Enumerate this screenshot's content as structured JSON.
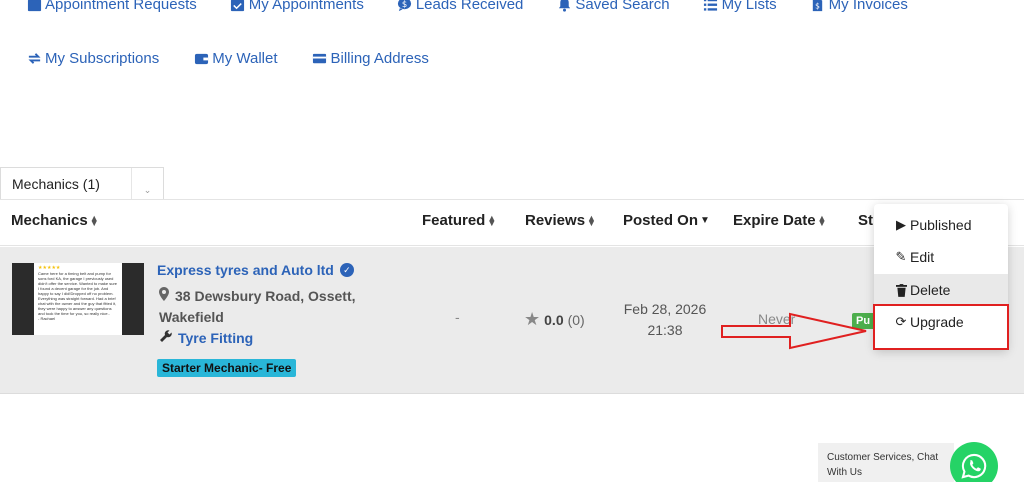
{
  "nav": {
    "row1": [
      {
        "label": "Appointment Requests",
        "icon": "calendar-icon"
      },
      {
        "label": "My Appointments",
        "icon": "calendar-check-icon"
      },
      {
        "label": "Leads Received",
        "icon": "dollar-bubble-icon"
      },
      {
        "label": "Saved Search",
        "icon": "bell-icon"
      },
      {
        "label": "My Lists",
        "icon": "list-icon"
      },
      {
        "label": "My Invoices",
        "icon": "invoice-icon"
      }
    ],
    "row2": [
      {
        "label": "My Subscriptions",
        "icon": "sync-icon"
      },
      {
        "label": "My Wallet",
        "icon": "wallet-icon"
      },
      {
        "label": "Billing Address",
        "icon": "card-icon"
      }
    ]
  },
  "tab": {
    "label": "Mechanics (1)",
    "caret": "⌄"
  },
  "table": {
    "headers": {
      "mechanics": "Mechanics",
      "featured": "Featured",
      "reviews": "Reviews",
      "posted_on": "Posted On",
      "expire_date": "Expire Date",
      "status": "St"
    },
    "row": {
      "thumbnail_text": "Came here for a timing belt and pump for sons ford KA, the garage I previously used didn't offer the service. Wanted to make sure I found a decent garage for the job. And happy to say I did!Dropped off no problem. Everything was straight forward. Had a brief chat with the owner and the guy that fitted it, they were happy to answer any questions and took the time for you, so really nice..",
      "thumbnail_author": "- Rachael",
      "thumbnail_stars": "★★★★★",
      "title": "Express tyres and Auto ltd",
      "verified_mark": "✓",
      "address": "38 Dewsbury Road, Ossett, Wakefield",
      "category": "Tyre Fitting",
      "plan": "Starter Mechanic- Free",
      "featured": "-",
      "rating": "0.0",
      "review_count": "(0)",
      "posted_date": "Feb 28, 2026",
      "posted_time": "21:38",
      "expire": "Never",
      "status_badge": "Pu"
    }
  },
  "dropdown": {
    "items": [
      {
        "label": "Published",
        "icon": "play-icon",
        "glyph": "▶"
      },
      {
        "label": "Edit",
        "icon": "pencil-icon",
        "glyph": "✎"
      },
      {
        "label": "Delete",
        "icon": "trash-icon",
        "glyph": "🗑"
      },
      {
        "label": "Upgrade",
        "icon": "refresh-icon",
        "glyph": "⟳"
      }
    ]
  },
  "chat": {
    "text": "Customer Services, Chat With Us"
  },
  "colors": {
    "link_blue": "#2c63b8",
    "row_bg": "#ebebeb",
    "plan_badge": "#29b6d8",
    "status_green": "#4cae4c",
    "annotation_red": "#e02020",
    "whatsapp_green": "#25d366"
  }
}
